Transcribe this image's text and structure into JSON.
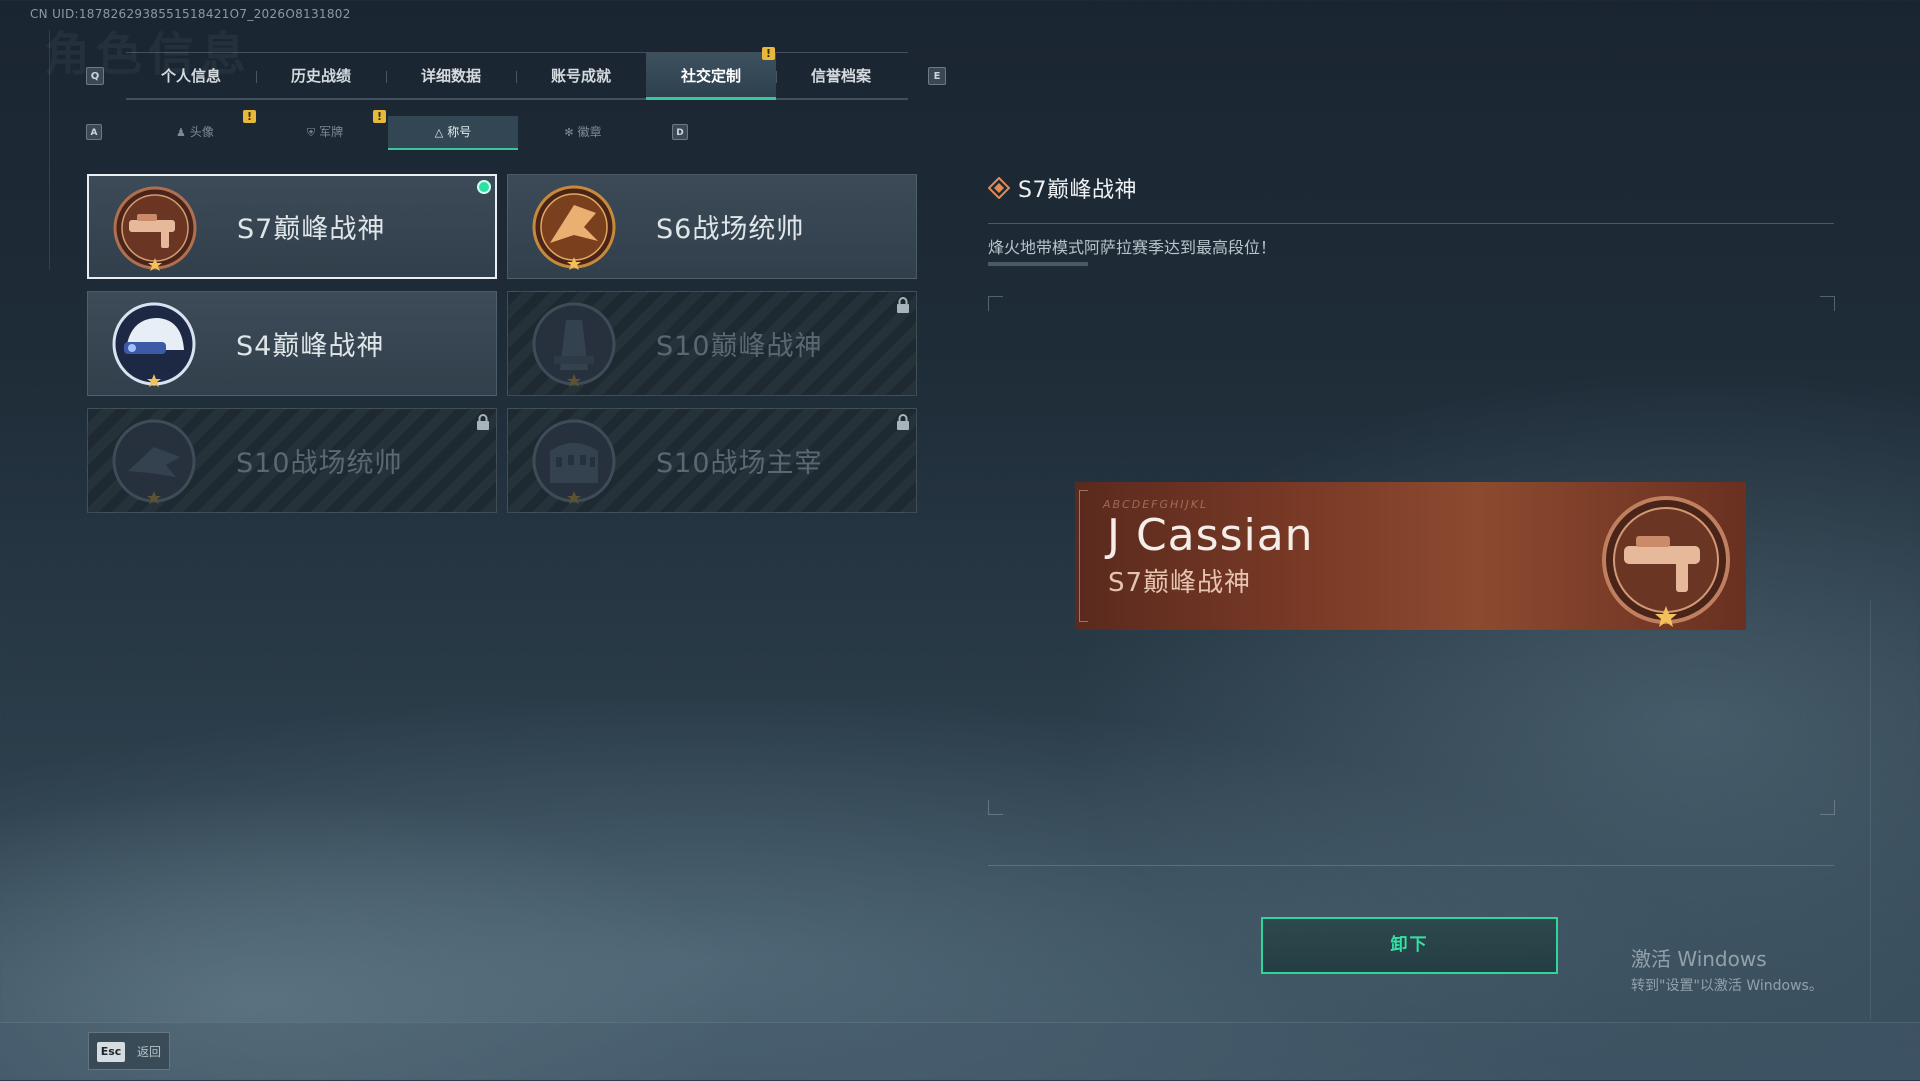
{
  "uid_text": "CN UID:1878262938551518421O7_2026O8131802",
  "header": {
    "ghost_title": "角色信息"
  },
  "tabs": {
    "left_key": "Q",
    "right_key": "E",
    "items": [
      {
        "label": "个人信息"
      },
      {
        "label": "历史战绩"
      },
      {
        "label": "详细数据"
      },
      {
        "label": "账号成就"
      },
      {
        "label": "社交定制"
      },
      {
        "label": "信誉档案"
      }
    ],
    "active_index": 4
  },
  "subtabs": {
    "left_key": "A",
    "right_key": "D",
    "items": [
      {
        "label": "头像",
        "icon": "person-icon"
      },
      {
        "label": "军牌",
        "icon": "dogtag-icon"
      },
      {
        "label": "称号",
        "icon": "triangle-icon"
      },
      {
        "label": "徽章",
        "icon": "badge-icon"
      }
    ],
    "active_index": 2
  },
  "titles": [
    {
      "name": "S7巅峰战神",
      "locked": false,
      "equipped": true,
      "selected": true
    },
    {
      "name": "S6战场统帅",
      "locked": false,
      "equipped": false,
      "selected": false
    },
    {
      "name": "S4巅峰战神",
      "locked": false,
      "equipped": false,
      "selected": false
    },
    {
      "name": "S10巅峰战神",
      "locked": true,
      "equipped": false,
      "selected": false
    },
    {
      "name": "S10战场统帅",
      "locked": true,
      "equipped": false,
      "selected": false
    },
    {
      "name": "S10战场主宰",
      "locked": true,
      "equipped": false,
      "selected": false
    }
  ],
  "detail": {
    "title": "S7巅峰战神",
    "description": "烽火地带模式阿萨拉赛季达到最高段位！"
  },
  "nameplate": {
    "code_text": "ABCDEFGHIJKL",
    "player_name": "J Cassian",
    "title": "S7巅峰战神"
  },
  "actions": {
    "unequip_label": "卸下"
  },
  "footer": {
    "esc_key": "Esc",
    "back_label": "返回"
  },
  "watermark": {
    "line1": "激活 Windows",
    "line2": "转到\"设置\"以激活 Windows。"
  },
  "colors": {
    "accent_green": "#39c79a",
    "warning_yellow": "#e6b93c",
    "plate_brown": "#7a3a26"
  }
}
